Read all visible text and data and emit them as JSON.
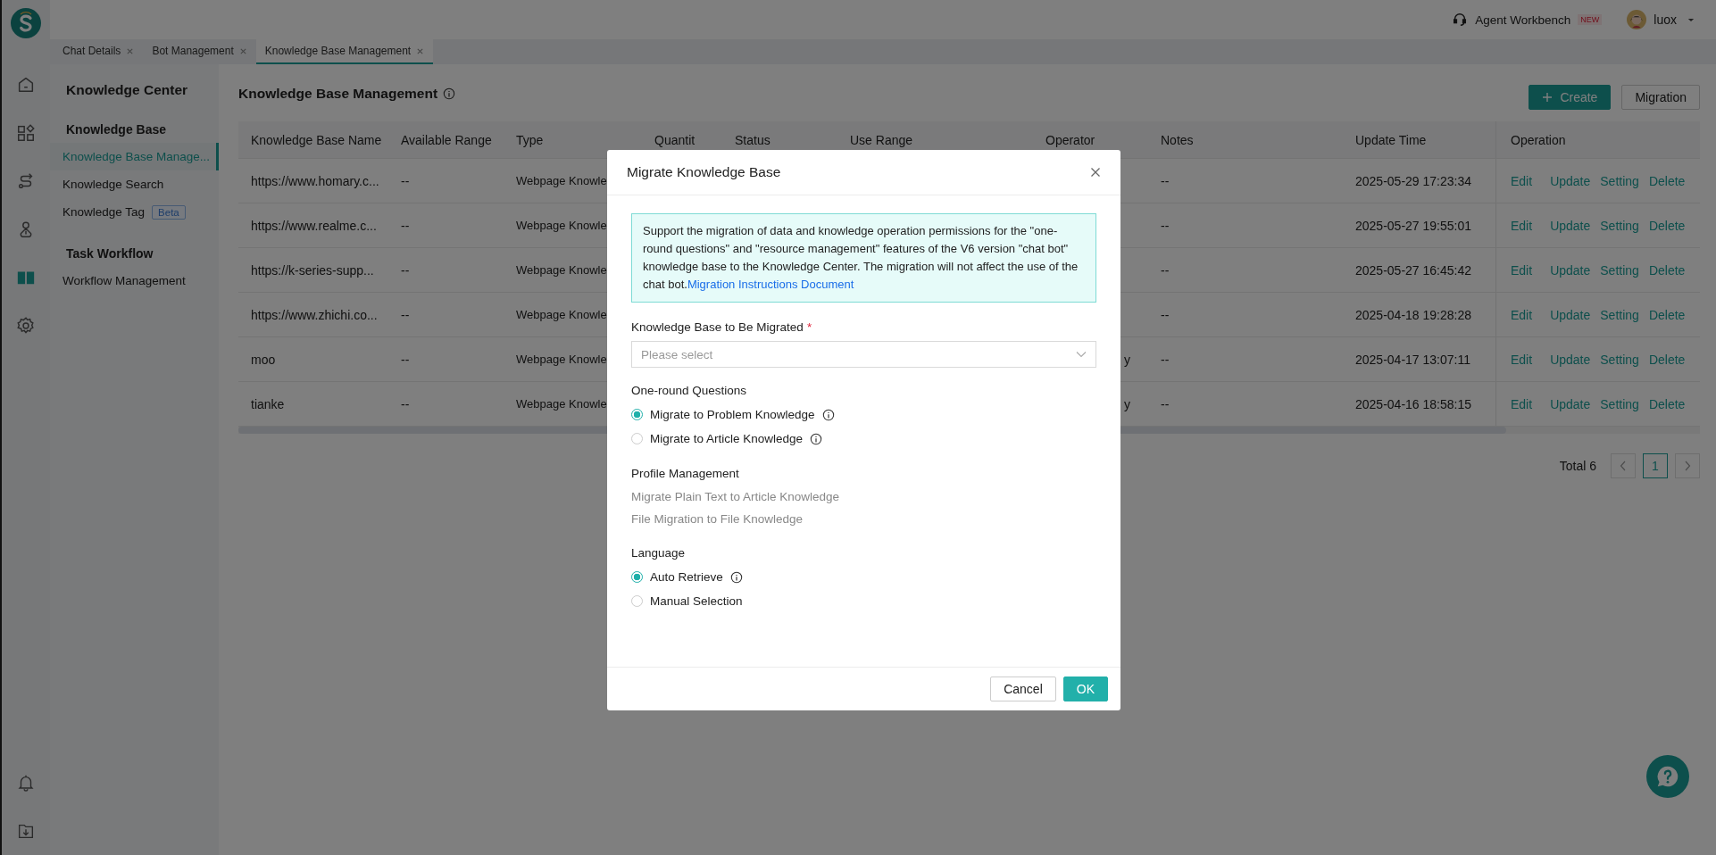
{
  "rail": [
    {
      "selected": false
    },
    {
      "selected": false
    },
    {
      "selected": false
    },
    {
      "selected": false
    },
    {
      "selected": true
    },
    {
      "selected": false
    }
  ],
  "topbar": {
    "workbench": "Agent Workbench",
    "badge": "NEW",
    "user": "luox"
  },
  "tabs": [
    {
      "label": "Chat Details",
      "selected": false
    },
    {
      "label": "Bot Management",
      "selected": false
    },
    {
      "label": "Knowledge Base Management",
      "selected": true
    }
  ],
  "nav": {
    "title": "Knowledge Center",
    "groups": [
      {
        "title": "Knowledge Base",
        "items": [
          {
            "label": "Knowledge Base Manage...",
            "selected": true
          },
          {
            "label": "Knowledge Search",
            "selected": false
          },
          {
            "label": "Knowledge Tag",
            "selected": false,
            "badge": "Beta"
          }
        ]
      },
      {
        "title": "Task Workflow",
        "items": [
          {
            "label": "Workflow Management",
            "selected": false
          }
        ]
      }
    ]
  },
  "page": {
    "title": "Knowledge Base Management",
    "create": "Create",
    "migration": "Migration"
  },
  "table": {
    "columns": [
      "Knowledge Base Name",
      "Available Range",
      "Type",
      "Quantit",
      "Status",
      "Use Range",
      "Operator",
      "Notes",
      "Update Time",
      "Operation"
    ],
    "rows": [
      {
        "name": "https://www.homary.c...",
        "range": "--",
        "type": "Webpage Knowle",
        "notes": "--",
        "time": "2025-05-29 17:23:34",
        "actions": [
          "Edit",
          "Update",
          "Setting",
          "Delete"
        ]
      },
      {
        "name": "https://www.realme.c...",
        "range": "--",
        "type": "Webpage Knowle",
        "notes": "--",
        "time": "2025-05-27 19:55:01",
        "actions": [
          "Edit",
          "Update",
          "Setting",
          "Delete"
        ]
      },
      {
        "name": "https://k-series-supp...",
        "range": "--",
        "type": "Webpage Knowle",
        "notes": "--",
        "time": "2025-05-27 16:45:42",
        "actions": [
          "Edit",
          "Update",
          "Setting",
          "Delete"
        ]
      },
      {
        "name": "https://www.zhichi.co...",
        "range": "--",
        "type": "Webpage Knowle",
        "notes": "--",
        "time": "2025-04-18 19:28:28",
        "actions": [
          "Edit",
          "Update",
          "Setting",
          "Delete"
        ]
      },
      {
        "name": "moo",
        "range": "--",
        "type": "Webpage Knowle",
        "operator": "y",
        "notes": "--",
        "time": "2025-04-17 13:07:11",
        "actions": [
          "Edit",
          "Update",
          "Setting",
          "Delete"
        ]
      },
      {
        "name": "tianke",
        "range": "--",
        "type": "Webpage Knowle",
        "operator": "y",
        "notes": "--",
        "time": "2025-04-16 18:58:15",
        "actions": [
          "Edit",
          "Update",
          "Setting",
          "Delete"
        ]
      }
    ]
  },
  "pagination": {
    "total": "Total 6",
    "pages": [
      {
        "label": "1",
        "selected": true
      }
    ]
  },
  "modal": {
    "title": "Migrate Knowledge Base",
    "notice": "Support the migration of data and knowledge operation permissions for the \"one-round questions\" and \"resource management\" features of the V6 version \"chat bot\" knowledge base to the Knowledge Center. The migration will not affect the use of the chat bot.",
    "notice_link": "Migration Instructions Document",
    "select": {
      "label": "Knowledge Base to Be Migrated",
      "required_mark": "*",
      "placeholder": "Please select"
    },
    "sections": [
      {
        "kind": "radio",
        "title": "One-round Questions",
        "options": [
          {
            "label": "Migrate to Problem Knowledge",
            "selected": true,
            "info": true
          },
          {
            "label": "Migrate to Article Knowledge",
            "selected": false,
            "info": true
          }
        ]
      },
      {
        "kind": "text",
        "title": "Profile Management",
        "options": [
          {
            "label": "Migrate Plain Text to Article Knowledge",
            "disabled": true
          },
          {
            "label": "File Migration to File Knowledge",
            "disabled": true
          }
        ]
      },
      {
        "kind": "radio",
        "title": "Language",
        "options": [
          {
            "label": "Auto Retrieve",
            "selected": true,
            "info": true
          },
          {
            "label": "Manual Selection",
            "selected": false,
            "info": false
          }
        ]
      }
    ],
    "cancel": "Cancel",
    "ok": "OK"
  }
}
